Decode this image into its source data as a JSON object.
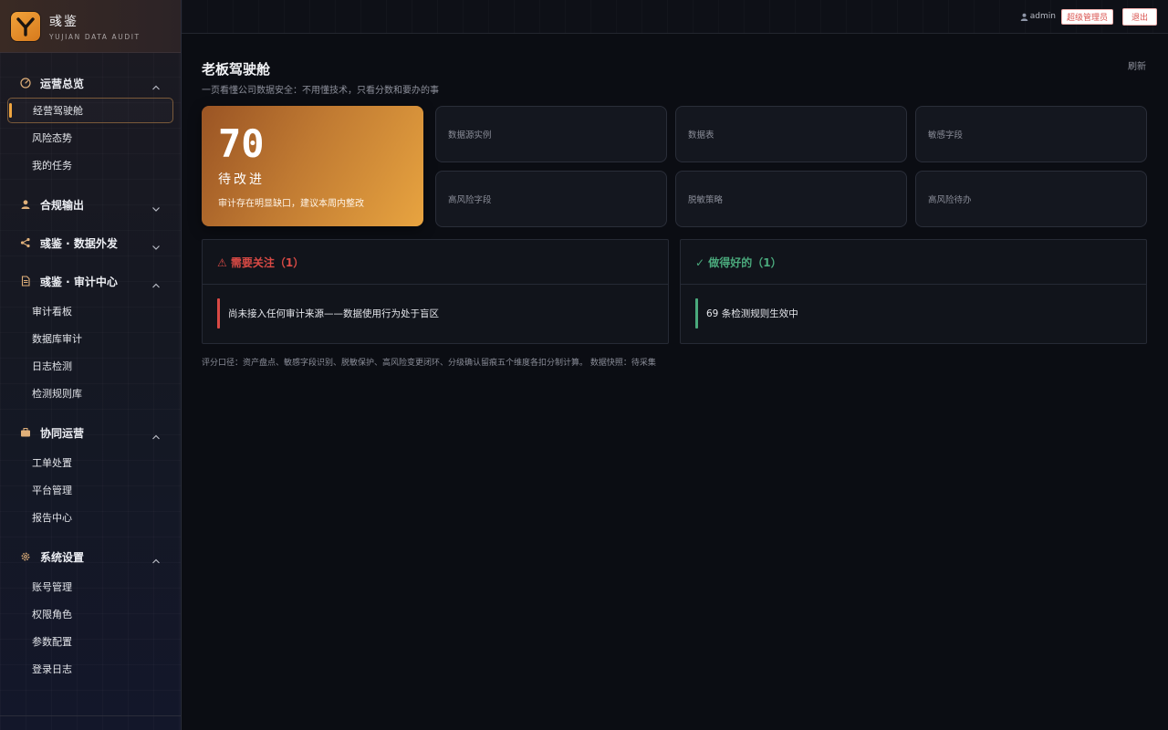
{
  "brand": {
    "name": "彧鉴",
    "subtitle": "YUJIAN DATA AUDIT"
  },
  "sidebar": {
    "groups": [
      {
        "label": "运营总览",
        "icon": "gauge-icon",
        "expanded": true,
        "items": [
          "经营驾驶舱",
          "风险态势",
          "我的任务"
        ]
      },
      {
        "label": "合规输出",
        "icon": "user-icon",
        "expanded": false,
        "items": []
      },
      {
        "label": "彧鉴 · 数据外发",
        "icon": "share-icon",
        "expanded": false,
        "items": []
      },
      {
        "label": "彧鉴 · 审计中心",
        "icon": "document-icon",
        "expanded": true,
        "items": [
          "审计看板",
          "数据库审计",
          "日志检测",
          "检测规则库"
        ]
      },
      {
        "label": "协同运营",
        "icon": "briefcase-icon",
        "expanded": true,
        "items": [
          "工单处置",
          "平台管理",
          "报告中心"
        ]
      },
      {
        "label": "系统设置",
        "icon": "gear-icon",
        "expanded": true,
        "items": [
          "账号管理",
          "权限角色",
          "参数配置",
          "登录日志"
        ]
      }
    ],
    "active_item": "经营驾驶舱"
  },
  "topbar": {
    "username": "admin",
    "role": "超级管理员",
    "logout_label": "退出"
  },
  "page": {
    "title": "老板驾驶舱",
    "subtitle": "一页看懂公司数据安全：不用懂技术，只看分数和要办的事",
    "refresh_label": "刷新"
  },
  "score": {
    "value": "70",
    "level": "待改进",
    "description": "审计存在明显缺口，建议本周内整改"
  },
  "stats": [
    {
      "label": "数据源实例"
    },
    {
      "label": "数据表"
    },
    {
      "label": "敏感字段"
    },
    {
      "label": "高风险字段"
    },
    {
      "label": "脱敏策略"
    },
    {
      "label": "高风险待办"
    }
  ],
  "attention": {
    "title": "⚠ 需要关注（1）",
    "items": [
      "尚未接入任何审计来源——数据使用行为处于盲区"
    ]
  },
  "good": {
    "title": "✓ 做得好的（1）",
    "items": [
      "69 条检测规则生效中"
    ]
  },
  "foot_note": "评分口径：资产盘点、敏感字段识别、脱敏保护、高风险变更闭环、分级确认留痕五个维度各扣分制计算。 数据快照：待采集",
  "colors": {
    "accent": "#f0a640",
    "danger": "#d94a45",
    "success": "#4aa97c"
  }
}
